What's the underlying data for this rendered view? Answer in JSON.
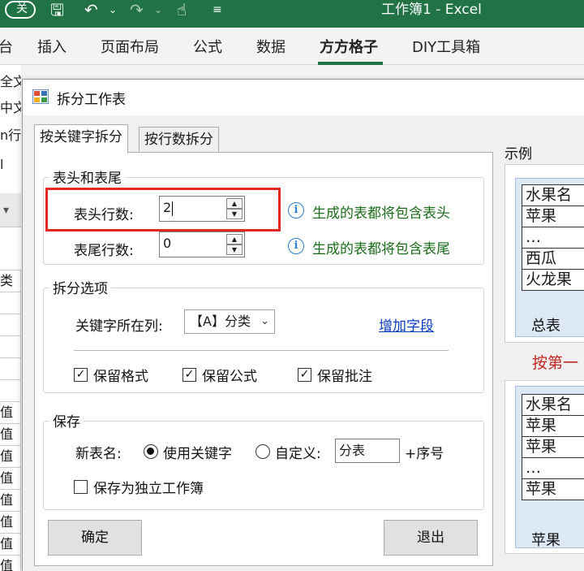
{
  "excel": {
    "title": "工作簿1 - Excel",
    "autosave_label": "关",
    "quick_icons": [
      "save-icon",
      "undo-icon",
      "redo-icon",
      "touch-mode-icon",
      "customize-icon"
    ],
    "ribbon_tabs": [
      "台",
      "插入",
      "页面布局",
      "公式",
      "数据",
      "方方格子",
      "DIY工具箱"
    ],
    "active_tab": "方方格子",
    "accent": "#217346",
    "left_strip": {
      "top_texts": [
        "全文",
        "中文",
        "n行",
        "l"
      ],
      "rows": [
        "类",
        "",
        "",
        "",
        "",
        "",
        "值",
        "值",
        "值",
        "值",
        "值",
        "值",
        "值",
        "值",
        "值"
      ]
    }
  },
  "dialog": {
    "title": "拆分工作表",
    "tabs": [
      "按关键字拆分",
      "按行数拆分"
    ],
    "active_tab": 0,
    "header_footer": {
      "group_label": "表头和表尾",
      "header_rows_label": "表头行数:",
      "header_rows_value": "2",
      "footer_rows_label": "表尾行数:",
      "footer_rows_value": "0",
      "header_hint": "生成的表都将包含表头",
      "footer_hint": "生成的表都将包含表尾"
    },
    "split_options": {
      "group_label": "拆分选项",
      "keyword_column_label": "关键字所在列:",
      "keyword_column_value": "【A】分类",
      "add_field_link": "增加字段",
      "keep_format": {
        "label": "保留格式",
        "checked": true
      },
      "keep_formula": {
        "label": "保留公式",
        "checked": true
      },
      "keep_comment": {
        "label": "保留批注",
        "checked": true
      }
    },
    "save": {
      "group_label": "保存",
      "new_sheet_name_label": "新表名:",
      "use_keyword_label": "使用关键字",
      "use_keyword_selected": true,
      "custom_label": "自定义:",
      "custom_value": "分表",
      "suffix_label": "+序号",
      "save_as_workbook_label": "保存为独立工作簿",
      "save_as_workbook_checked": false
    },
    "ok_button": "确定",
    "exit_button": "退出",
    "example": {
      "label": "示例",
      "top_table": [
        "水果名",
        "苹果",
        "…",
        "西瓜",
        "火龙果"
      ],
      "top_sheet_tab": "总表",
      "note": "按第一",
      "bottom_table": [
        "水果名",
        "苹果",
        "苹果",
        "…",
        "苹果"
      ],
      "bottom_sheet_tab": "苹果"
    }
  }
}
